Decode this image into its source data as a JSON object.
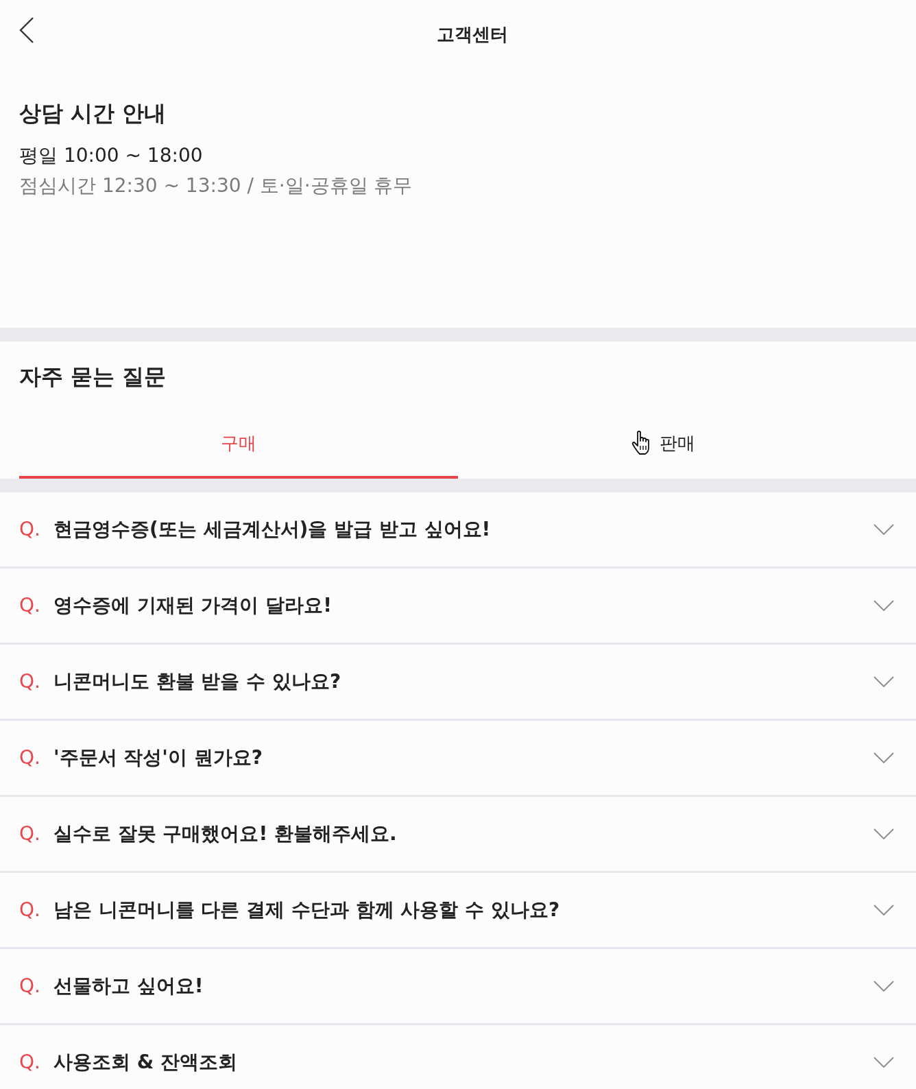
{
  "header": {
    "title": "고객센터"
  },
  "hours": {
    "title": "상담 시간 안내",
    "weekday": "평일 10:00 ~ 18:00",
    "note": "점심시간 12:30 ~ 13:30 / 토·일·공휴일 휴무"
  },
  "faq": {
    "title": "자주 묻는 질문",
    "tabs": [
      {
        "label": "구매",
        "selected": true
      },
      {
        "label": "판매",
        "selected": false
      }
    ],
    "items": [
      {
        "marker": "Q.",
        "question": "현금영수증(또는 세금계산서)을 발급 받고 싶어요!",
        "expanded": false
      },
      {
        "marker": "Q.",
        "question": "영수증에 기재된 가격이 달라요!",
        "expanded": false
      },
      {
        "marker": "Q.",
        "question": "니콘머니도 환불 받을 수 있나요?",
        "expanded": false
      },
      {
        "marker": "Q.",
        "question": "'주문서 작성'이 뭔가요?",
        "expanded": false
      },
      {
        "marker": "Q.",
        "question": "실수로 잘못 구매했어요! 환불해주세요.",
        "expanded": false
      },
      {
        "marker": "Q.",
        "question": "남은 니콘머니를 다른 결제 수단과 함께 사용할 수 있나요?",
        "expanded": false
      },
      {
        "marker": "Q.",
        "question": "선물하고 싶어요!",
        "expanded": false
      },
      {
        "marker": "Q.",
        "question": "사용조회 & 잔액조회",
        "expanded": false
      }
    ]
  }
}
